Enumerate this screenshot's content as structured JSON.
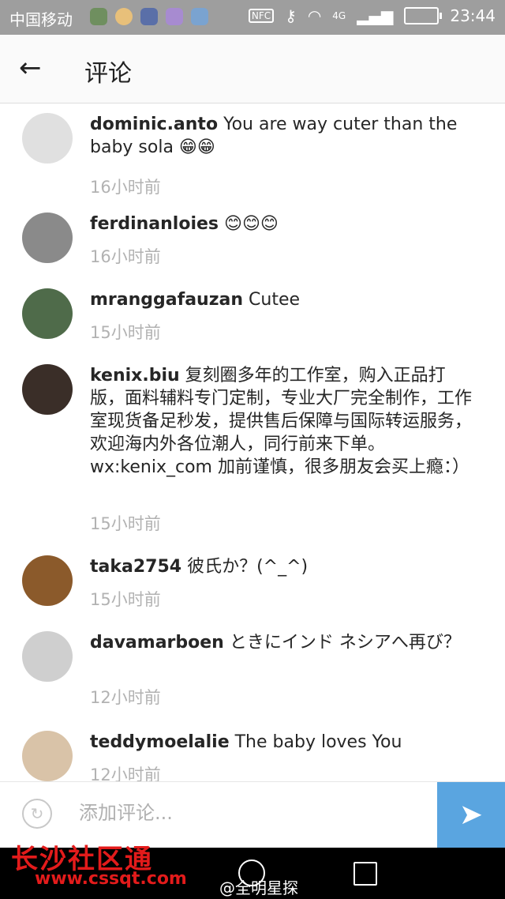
{
  "status_bar": {
    "carrier": "中国移动",
    "network": "4G",
    "nfc": "NFC",
    "time": "23:44"
  },
  "app_bar": {
    "title": "评论",
    "back_icon": "arrow-left-icon"
  },
  "comments": [
    {
      "username": "dominic.anto",
      "text": " You are way cuter than the baby sola 😁😁",
      "time": "16小时前",
      "avatar_color": "#e0e0e0"
    },
    {
      "username": "ferdinanloies",
      "text": " 😊😊😊",
      "time": "16小时前",
      "avatar_color": "#8a8a8a"
    },
    {
      "username": "mranggafauzan",
      "text": " Cutee",
      "time": "15小时前",
      "avatar_color": "#4f6b4a"
    },
    {
      "username": "kenix.biu",
      "text": " 复刻圈多年的工作室，购入正品打版，面料辅料专门定制，专业大厂完全制作，工作室现货备足秒发，提供售后保障与国际转运服务，欢迎海内外各位潮人，同行前来下单。wx:kenix_com 加前谨慎，很多朋友会买上瘾：）",
      "time": "15小时前",
      "avatar_color": "#3a2e28"
    },
    {
      "username": "taka2754",
      "text": " 彼氏か？(^_^)",
      "time": "15小时前",
      "avatar_color": "#8b5a2b"
    },
    {
      "username": "davamarboen",
      "text": " ときにインド ネシアへ再び？",
      "time": "12小时前",
      "avatar_color": "#cfcfcf"
    },
    {
      "username": "teddymoelalie",
      "text": " The baby loves You",
      "time": "12小时前",
      "avatar_color": "#d9c3a8"
    }
  ],
  "input_bar": {
    "placeholder": "添加评论...",
    "reply_icon": "reply-icon",
    "send_icon": "send-icon"
  },
  "watermarks": {
    "site_name": "长沙社区通",
    "site_url": "www.cssqt.com",
    "weibo": "@全明星探"
  },
  "colors": {
    "accent": "#5aa5e0",
    "time_gray": "#b2b2b2",
    "status_bar": "#9e9e9e"
  }
}
